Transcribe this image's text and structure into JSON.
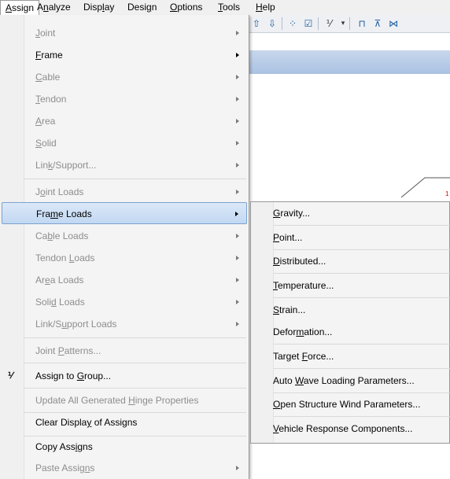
{
  "menubar": {
    "items": [
      {
        "pre": "",
        "ul": "A",
        "post": "ssign"
      },
      {
        "pre": "A",
        "ul": "n",
        "post": "alyze"
      },
      {
        "pre": "Disp",
        "ul": "l",
        "post": "ay"
      },
      {
        "pre": "Desi",
        "ul": "g",
        "post": "n"
      },
      {
        "pre": "",
        "ul": "O",
        "post": "ptions"
      },
      {
        "pre": "",
        "ul": "T",
        "post": "ools"
      },
      {
        "pre": "",
        "ul": "H",
        "post": "elp"
      }
    ]
  },
  "assign_menu": {
    "items": [
      {
        "pre": "",
        "ul": "J",
        "post": "oint"
      },
      {
        "pre": "",
        "ul": "F",
        "post": "rame"
      },
      {
        "pre": "",
        "ul": "C",
        "post": "able"
      },
      {
        "pre": "",
        "ul": "T",
        "post": "endon"
      },
      {
        "pre": "",
        "ul": "A",
        "post": "rea"
      },
      {
        "pre": "",
        "ul": "S",
        "post": "olid"
      },
      {
        "pre": "Lin",
        "ul": "k",
        "post": "/Support..."
      },
      {
        "pre": "J",
        "ul": "o",
        "post": "int Loads"
      },
      {
        "pre": "Fra",
        "ul": "m",
        "post": "e Loads"
      },
      {
        "pre": "Ca",
        "ul": "b",
        "post": "le Loads"
      },
      {
        "pre": "Tendon ",
        "ul": "L",
        "post": "oads"
      },
      {
        "pre": "Ar",
        "ul": "e",
        "post": "a Loads"
      },
      {
        "pre": "Soli",
        "ul": "d",
        "post": " Loads"
      },
      {
        "pre": "Link/S",
        "ul": "u",
        "post": "pport Loads"
      },
      {
        "pre": "Joint ",
        "ul": "P",
        "post": "atterns..."
      },
      {
        "pre": "Assign to ",
        "ul": "G",
        "post": "roup..."
      },
      {
        "pre": "Update All Generated ",
        "ul": "H",
        "post": "inge Properties"
      },
      {
        "pre": "Clear Displa",
        "ul": "y",
        "post": " of Assigns"
      },
      {
        "pre": "Copy Ass",
        "ul": "i",
        "post": "gns"
      },
      {
        "pre": "Paste Assig",
        "ul": "n",
        "post": "s"
      }
    ]
  },
  "frame_loads_submenu": {
    "items": [
      {
        "pre": "",
        "ul": "G",
        "post": "ravity..."
      },
      {
        "pre": "",
        "ul": "P",
        "post": "oint..."
      },
      {
        "pre": "",
        "ul": "D",
        "post": "istributed..."
      },
      {
        "pre": "",
        "ul": "T",
        "post": "emperature..."
      },
      {
        "pre": "",
        "ul": "S",
        "post": "train..."
      },
      {
        "pre": "Defor",
        "ul": "m",
        "post": "ation..."
      },
      {
        "pre": "Target ",
        "ul": "F",
        "post": "orce..."
      },
      {
        "pre": "Auto ",
        "ul": "W",
        "post": "ave Loading Parameters..."
      },
      {
        "pre": "",
        "ul": "O",
        "post": "pen Structure Wind Parameters..."
      },
      {
        "pre": "",
        "ul": "V",
        "post": "ehicle Response Components..."
      }
    ]
  },
  "canvas": {
    "joint_label": "1"
  },
  "colors": {
    "highlight": "#c2d8f2",
    "disabled_text": "#8d8d8d",
    "joint_label": "#cc0000"
  }
}
